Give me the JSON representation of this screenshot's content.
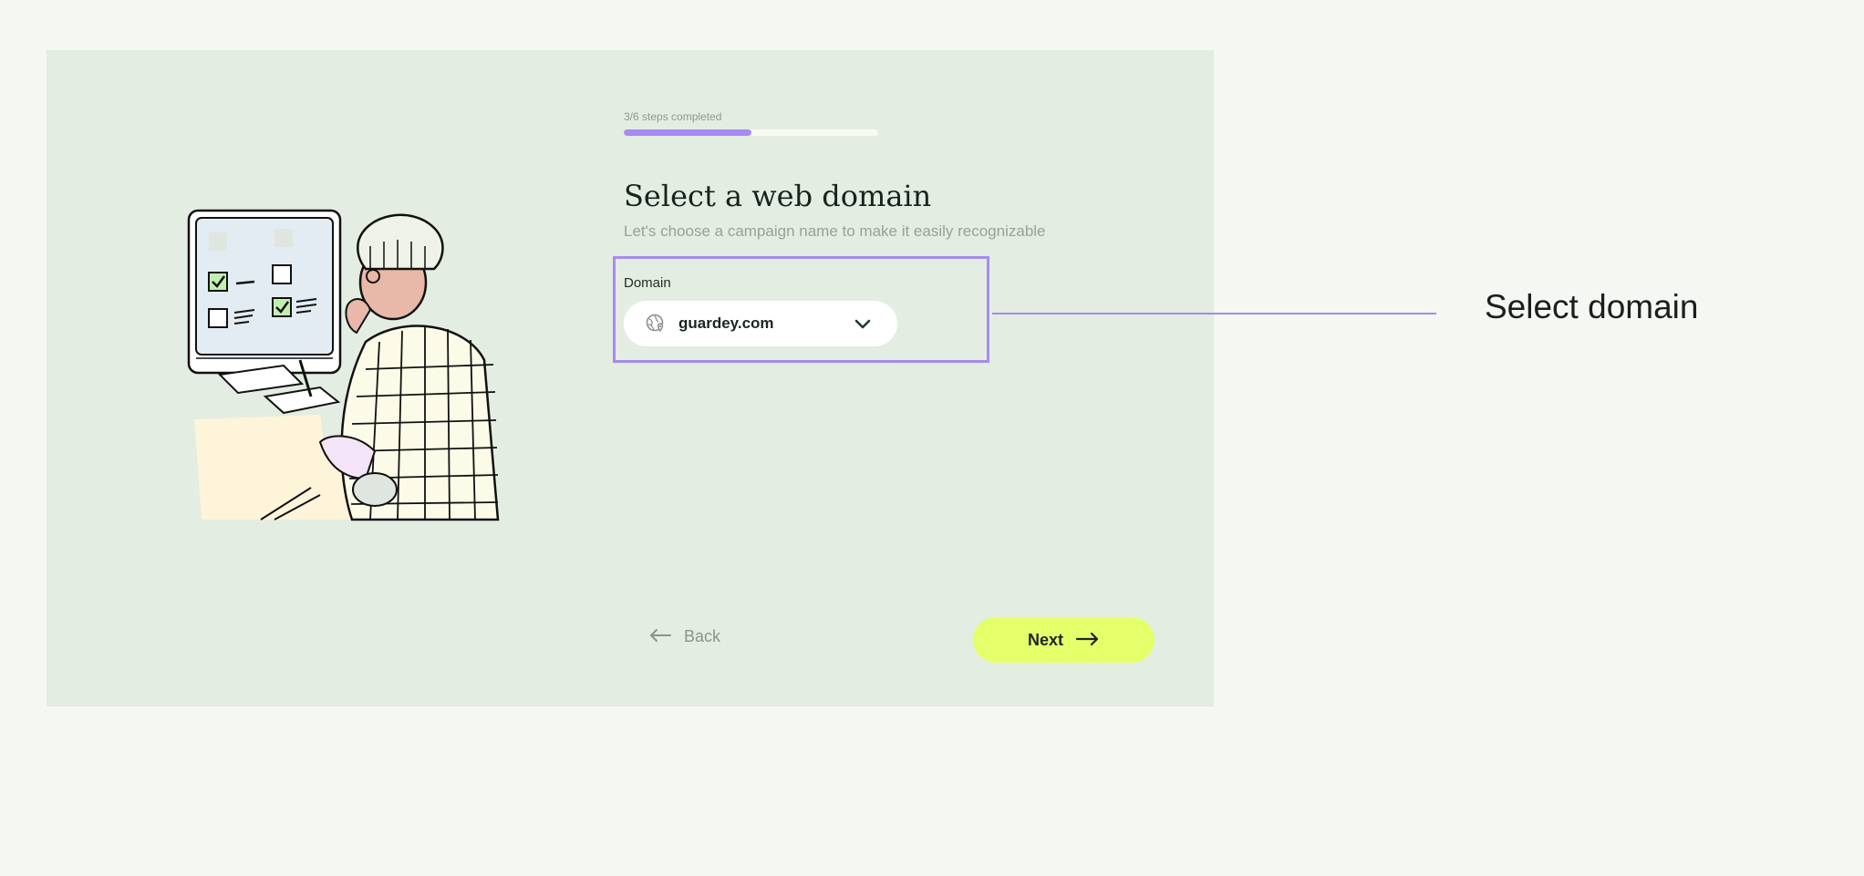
{
  "progress": {
    "label": "3/6 steps completed",
    "fraction": 0.5
  },
  "heading": {
    "title": "Select a web domain",
    "subtitle": "Let's choose a campaign name to make it easily recognizable"
  },
  "domain_field": {
    "label": "Domain",
    "value": "guardey.com",
    "icon": "globe-location-icon"
  },
  "callout": {
    "text": "Select domain"
  },
  "nav": {
    "back_label": "Back",
    "next_label": "Next"
  },
  "colors": {
    "accent": "#a68bf1",
    "next_button": "#e5ff6b",
    "panel_bg": "#e3ede2"
  }
}
